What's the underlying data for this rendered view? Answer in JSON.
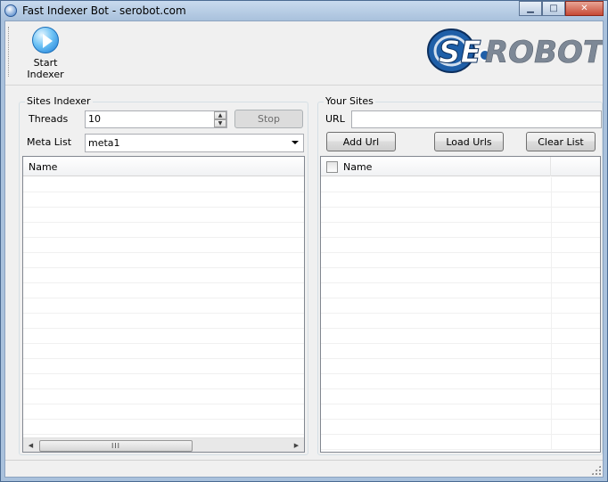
{
  "window": {
    "title": "Fast Indexer Bot - serobot.com",
    "controls": {
      "minimize": "▁",
      "maximize": "□",
      "close": "✕"
    }
  },
  "toolbar": {
    "start_label": "Start Indexer",
    "start_icon": "play-icon",
    "logo_text": {
      "prefix": "SE",
      "suffix": "ROBOT"
    },
    "logo_colors": {
      "primary": "#1f5fa8",
      "dark": "#0c2f5e",
      "text": "#7d8896"
    }
  },
  "sites_indexer": {
    "title": "Sites Indexer",
    "threads_label": "Threads",
    "threads_value": "10",
    "stop_label": "Stop",
    "meta_list_label": "Meta List",
    "meta_list_value": "meta1",
    "list": {
      "columns": [
        "Name"
      ],
      "scroll_thumb": "III"
    }
  },
  "your_sites": {
    "title": "Your Sites",
    "url_label": "URL",
    "url_value": "",
    "add_url_label": "Add Url",
    "load_urls_label": "Load Urls",
    "clear_list_label": "Clear List",
    "list": {
      "columns": [
        "Name",
        ""
      ]
    }
  }
}
